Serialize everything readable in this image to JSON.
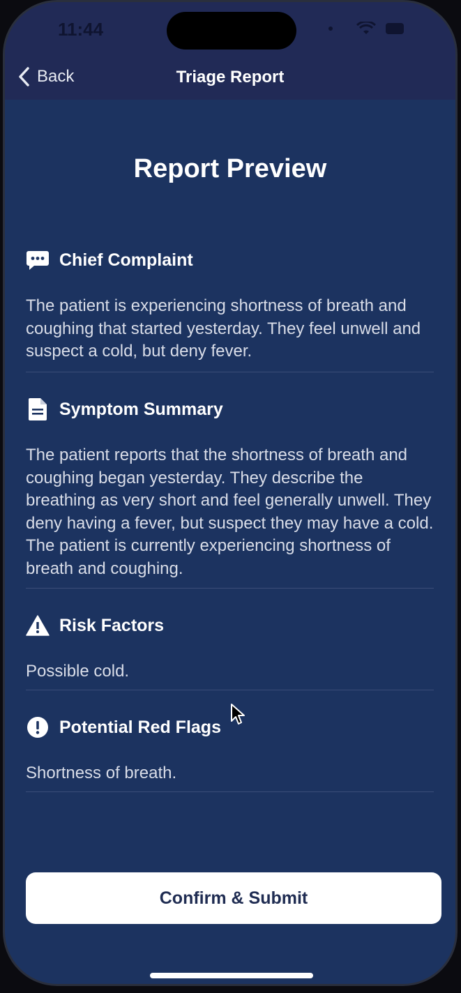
{
  "status_bar": {
    "time": "11:44"
  },
  "nav": {
    "back_label": "Back",
    "title": "Triage Report"
  },
  "page": {
    "heading": "Report Preview"
  },
  "sections": [
    {
      "icon": "speech-bubble-icon",
      "title": "Chief Complaint",
      "body": "The patient is experiencing shortness of breath and coughing that started yesterday. They feel unwell and suspect a cold, but deny fever."
    },
    {
      "icon": "document-icon",
      "title": "Symptom Summary",
      "body": "The patient reports that the shortness of breath and coughing began yesterday. They describe the breathing as very short and feel generally unwell. They deny having a fever, but suspect they may have a cold. The patient is currently experiencing shortness of breath and coughing."
    },
    {
      "icon": "warning-triangle-icon",
      "title": "Risk Factors",
      "body": "Possible cold."
    },
    {
      "icon": "exclamation-circle-icon",
      "title": "Potential Red Flags",
      "body": "Shortness of breath."
    }
  ],
  "actions": {
    "submit_label": "Confirm & Submit"
  },
  "colors": {
    "background": "#1c3360",
    "header": "#212a56",
    "button": "#ffffff",
    "button_text": "#1f2c52"
  }
}
